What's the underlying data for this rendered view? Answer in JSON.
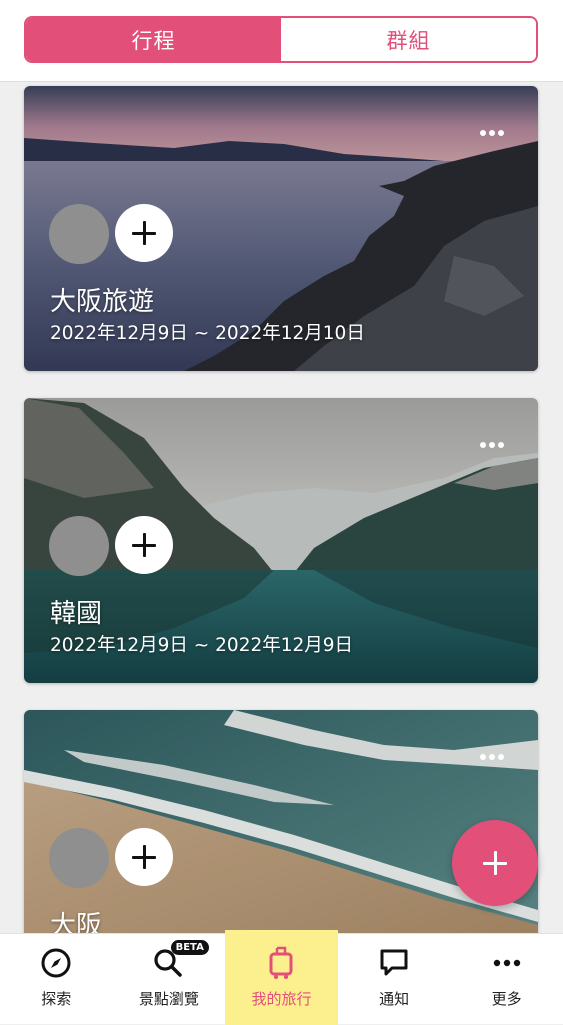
{
  "tabs": [
    {
      "label": "行程",
      "active": true
    },
    {
      "label": "群組",
      "active": false
    }
  ],
  "trips": [
    {
      "title": "大阪旅遊",
      "dates": "2022年12月9日 ~ 2022年12月10日",
      "background": "rocky coastline at dusk"
    },
    {
      "title": "韓國",
      "dates": "2022年12月9日 ~ 2022年12月9日",
      "background": "mountain lake reflection"
    },
    {
      "title": "大阪",
      "dates": "",
      "background": "beach with waves"
    }
  ],
  "nav": {
    "items": [
      {
        "label": "探索",
        "icon": "compass-icon"
      },
      {
        "label": "景點瀏覽",
        "icon": "search-icon",
        "badge": "BETA"
      },
      {
        "label": "我的旅行",
        "icon": "luggage-icon",
        "active": true
      },
      {
        "label": "通知",
        "icon": "chat-bubble-icon"
      },
      {
        "label": "更多",
        "icon": "more-icon"
      }
    ]
  },
  "colors": {
    "accent": "#e2507a",
    "active_nav_highlight": "#fbf08d",
    "avatar_placeholder": "#8f8f8f"
  }
}
